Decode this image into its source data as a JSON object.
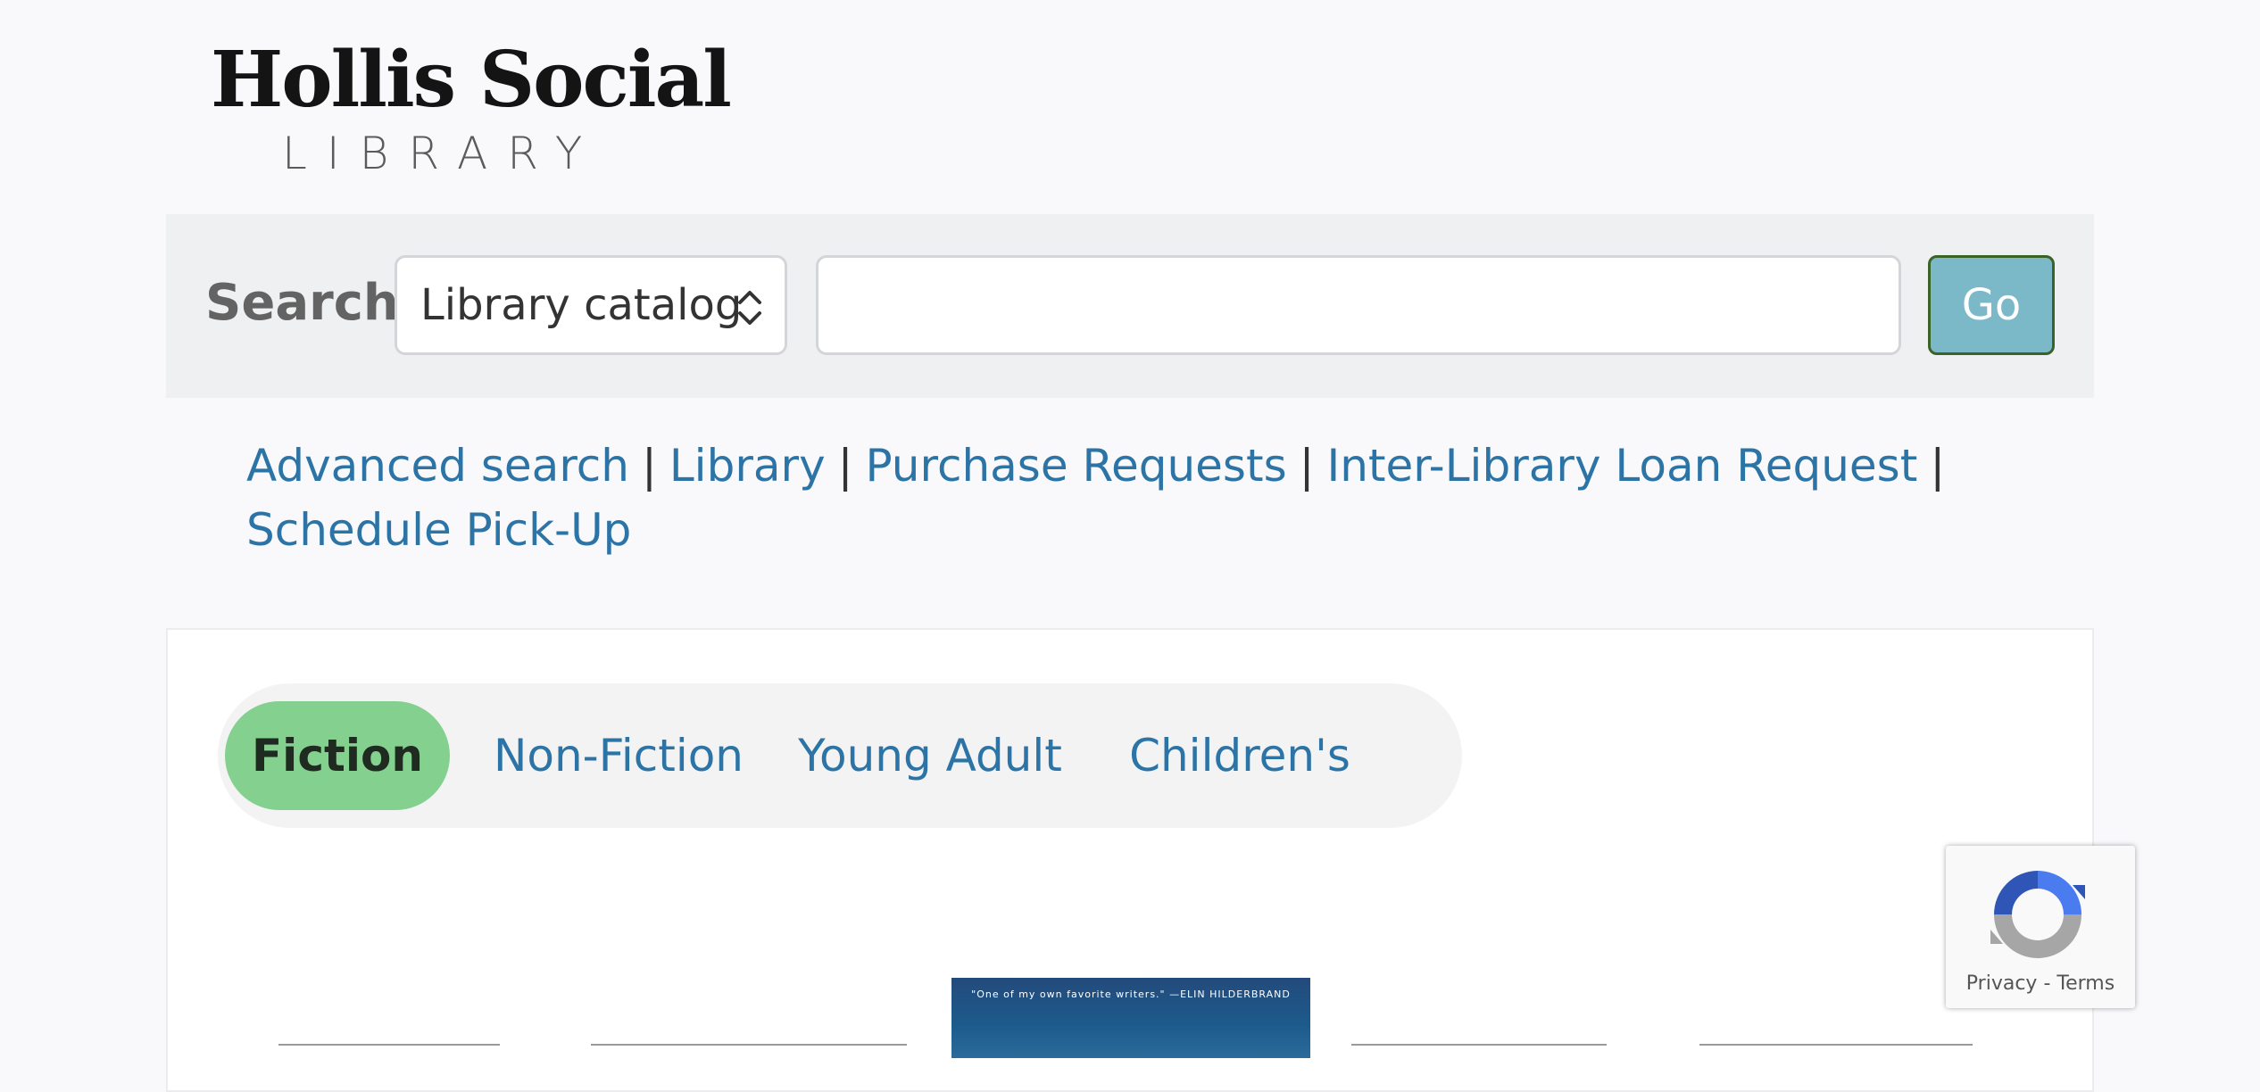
{
  "logo": {
    "title": "Hollis Social",
    "subtitle": "LIBRARY"
  },
  "search": {
    "label": "Search",
    "scope_selected": "Library catalog",
    "query_value": "",
    "go_label": "Go"
  },
  "links": {
    "items": [
      "Advanced search",
      "Library",
      "Purchase Requests",
      "Inter-Library Loan Request",
      "Schedule Pick-Up"
    ],
    "separator": "|"
  },
  "tabs": {
    "items": [
      "Fiction",
      "Non-Fiction",
      "Young Adult",
      "Children's"
    ],
    "active": "Fiction"
  },
  "book": {
    "cover_quote": "\"One of my own favorite writers.\" —ELIN HILDERBRAND"
  },
  "recaptcha": {
    "privacy": "Privacy",
    "dash": "-",
    "terms": "Terms"
  },
  "colors": {
    "background": "#f9f8fb",
    "search_bar": "#eff0f2",
    "go_button": "#7bb8c8",
    "link": "#2c74a6",
    "active_tab": "#84d08f"
  },
  "icons": {
    "select_arrows": "chevron-up-down-icon",
    "recaptcha": "recaptcha-icon"
  }
}
